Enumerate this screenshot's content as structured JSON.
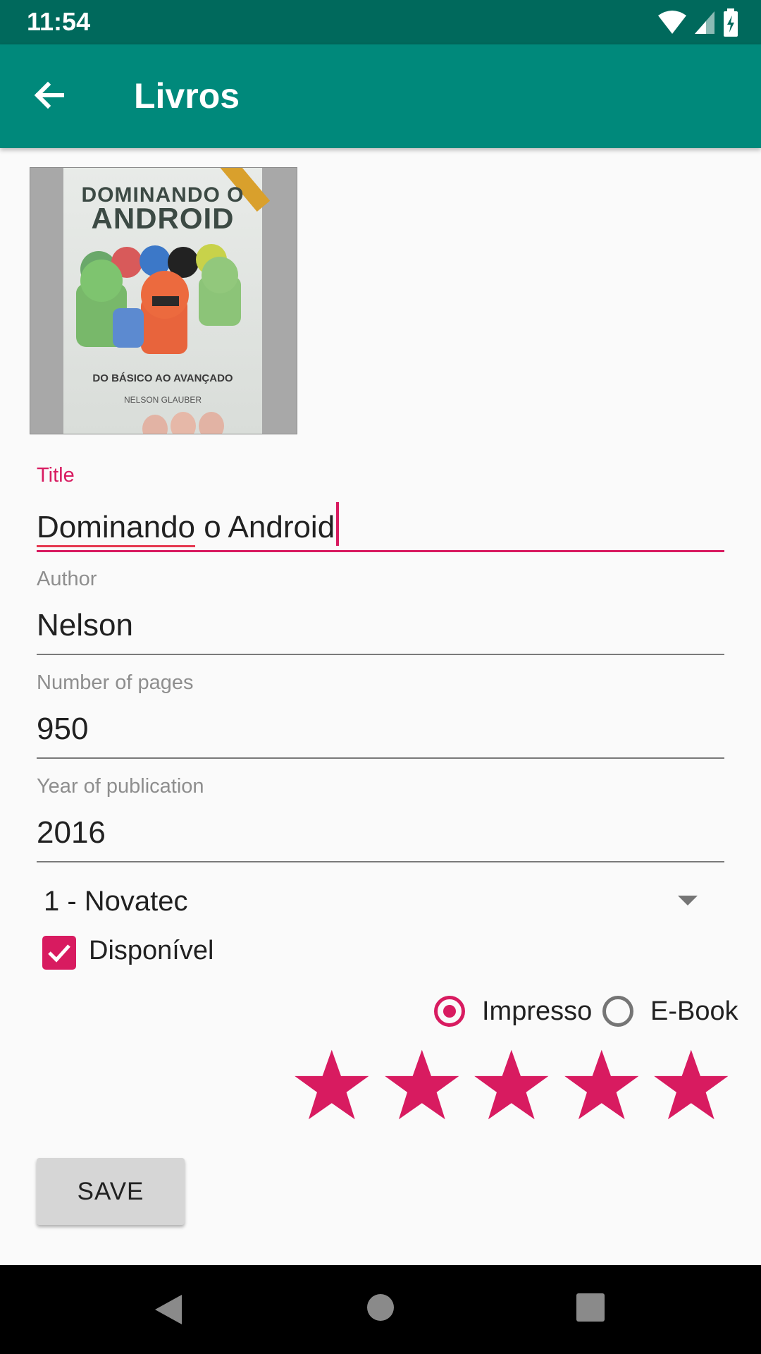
{
  "status_bar": {
    "time": "11:54"
  },
  "app_bar": {
    "title": "Livros"
  },
  "cover": {
    "title_line1": "DOMINANDO O",
    "title_line2": "ANDROID",
    "subtitle": "DO BÁSICO AO AVANÇADO",
    "author": "NELSON GLAUBER"
  },
  "form": {
    "title": {
      "label": "Title",
      "value": "Dominando o Android",
      "value_misspelled_part": "Dominando",
      "value_rest": " o Android"
    },
    "author": {
      "label": "Author",
      "value": "Nelson"
    },
    "pages": {
      "label": "Number of pages",
      "value": "950"
    },
    "year": {
      "label": "Year of publication",
      "value": "2016"
    },
    "publisher": {
      "selected": "1 - Novatec"
    },
    "available": {
      "label": "Disponível",
      "checked": true
    },
    "format": {
      "options": [
        {
          "label": "Impresso",
          "selected": true
        },
        {
          "label": "E-Book",
          "selected": false
        }
      ]
    },
    "rating": {
      "value": 5,
      "max": 5
    }
  },
  "save_button": {
    "label": "SAVE"
  },
  "colors": {
    "accent": "#d81b60",
    "primary": "#00897b",
    "primary_dark": "#00695c"
  }
}
